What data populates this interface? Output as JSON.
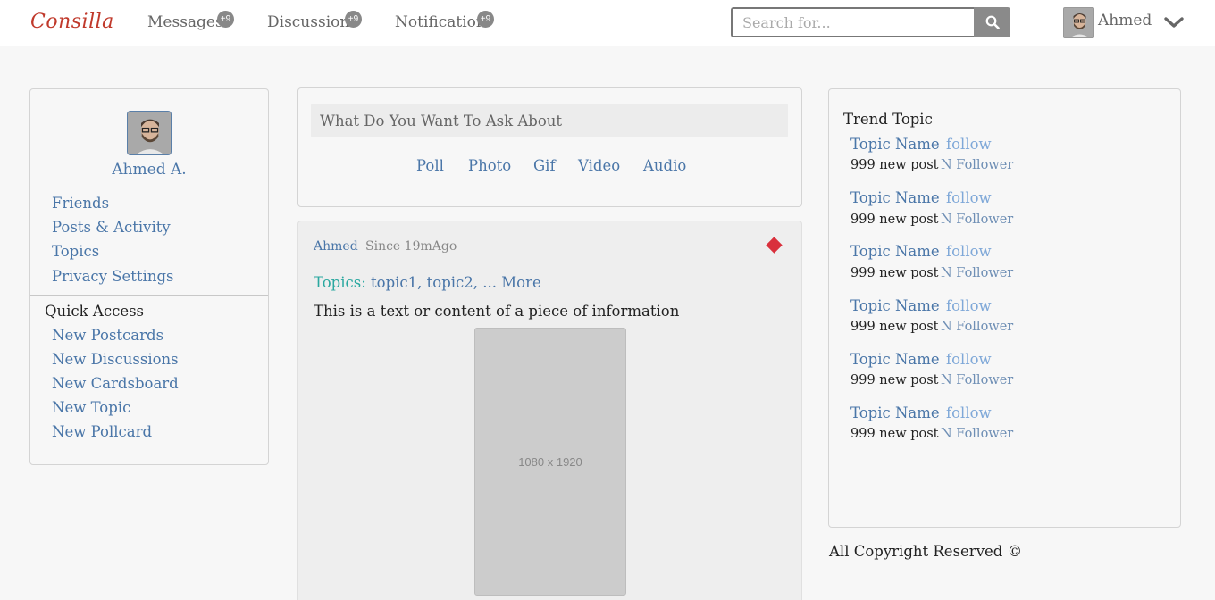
{
  "nav": {
    "logo": "Consilla",
    "messages_label": "Messages",
    "messages_badge": "+9",
    "discussion_label": "Discussion",
    "discussion_badge": "+9",
    "notification_label": "Notification",
    "notification_badge": "+9",
    "search_placeholder": "Search for...",
    "search_icon": "search-icon",
    "user_name": "Ahmed",
    "menu_icon": "chevron-down-icon"
  },
  "profile": {
    "name": "Ahmed A.",
    "links": [
      "Friends",
      "Posts & Activity",
      "Topics",
      "Privacy Settings"
    ]
  },
  "quick_access": {
    "title": "Quick Access",
    "links": [
      "New Postcards",
      "New Discussions",
      "New Cardsboard",
      "New Topic",
      "New Pollcard"
    ]
  },
  "ask": {
    "placeholder": "What Do You Want To Ask About",
    "options": [
      "Poll",
      "Photo",
      "Gif",
      "Video",
      "Audio"
    ]
  },
  "post": {
    "author": "Ahmed",
    "time": "Since 19mAgo",
    "topics_label": "Topics:",
    "topics_value": "topic1, topic2, ... More",
    "text": "This is a text or content of a piece of information",
    "image_placeholder": "1080 x 1920",
    "accent_color": "#d9303c"
  },
  "trend": {
    "title": "Trend Topic",
    "items": [
      {
        "name": "Topic Name",
        "follow": "follow",
        "posts": "999 new post",
        "followers": "N Follower"
      },
      {
        "name": "Topic Name",
        "follow": "follow",
        "posts": "999 new post",
        "followers": "N Follower"
      },
      {
        "name": "Topic Name",
        "follow": "follow",
        "posts": "999 new post",
        "followers": "N Follower"
      },
      {
        "name": "Topic Name",
        "follow": "follow",
        "posts": "999 new post",
        "followers": "N Follower"
      },
      {
        "name": "Topic Name",
        "follow": "follow",
        "posts": "999 new post",
        "followers": "N Follower"
      },
      {
        "name": "Topic Name",
        "follow": "follow",
        "posts": "999 new post",
        "followers": "N Follower"
      }
    ]
  },
  "footer": {
    "copyright": "All Copyright Reserved ©"
  },
  "colors": {
    "link": "#4a76a8",
    "logo": "#c0392b",
    "topics_label": "#2ba8a0"
  }
}
